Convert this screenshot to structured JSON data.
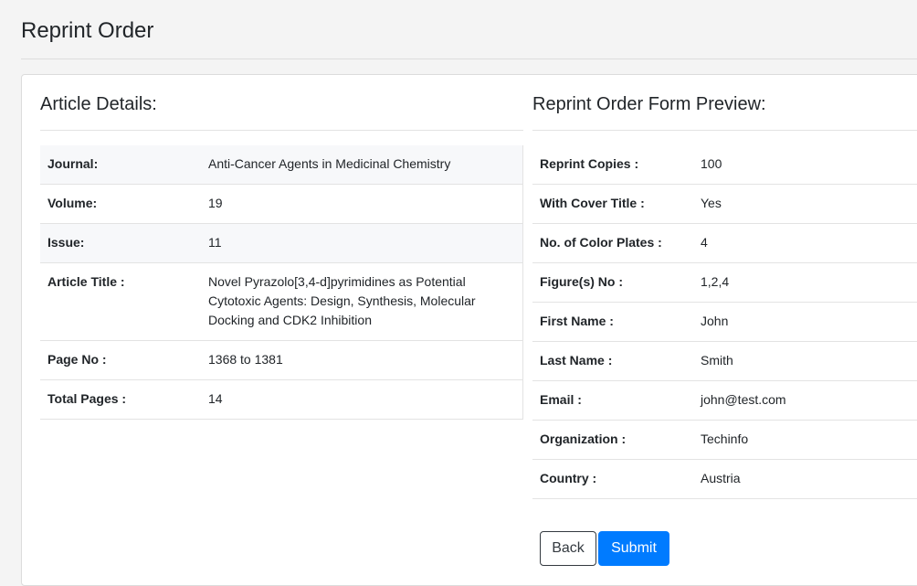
{
  "page": {
    "title": "Reprint Order"
  },
  "article": {
    "heading": "Article Details:",
    "rows": [
      {
        "label": "Journal:",
        "value": "Anti-Cancer Agents in Medicinal Chemistry"
      },
      {
        "label": "Volume:",
        "value": "19"
      },
      {
        "label": "Issue:",
        "value": "11"
      },
      {
        "label": "Article Title :",
        "value": "Novel Pyrazolo[3,4-d]pyrimidines as Potential Cytotoxic Agents: Design, Synthesis, Molecular Docking and CDK2 Inhibition"
      },
      {
        "label": "Page No :",
        "value": "1368 to 1381"
      },
      {
        "label": "Total Pages :",
        "value": "14"
      }
    ]
  },
  "preview": {
    "heading": "Reprint Order Form Preview:",
    "rows": [
      {
        "label": "Reprint Copies :",
        "value": "100"
      },
      {
        "label": "With Cover Title :",
        "value": "Yes"
      },
      {
        "label": "No. of Color Plates :",
        "value": "4"
      },
      {
        "label": "Figure(s) No :",
        "value": "1,2,4"
      },
      {
        "label": "First Name :",
        "value": "John"
      },
      {
        "label": "Last Name :",
        "value": "Smith"
      },
      {
        "label": "Email :",
        "value": "john@test.com"
      },
      {
        "label": "Organization :",
        "value": "Techinfo"
      },
      {
        "label": "Country :",
        "value": "Austria"
      }
    ]
  },
  "actions": {
    "back_label": "Back",
    "submit_label": "Submit"
  },
  "colors": {
    "primary": "#007bff",
    "stripe": "#f7f8fa"
  }
}
